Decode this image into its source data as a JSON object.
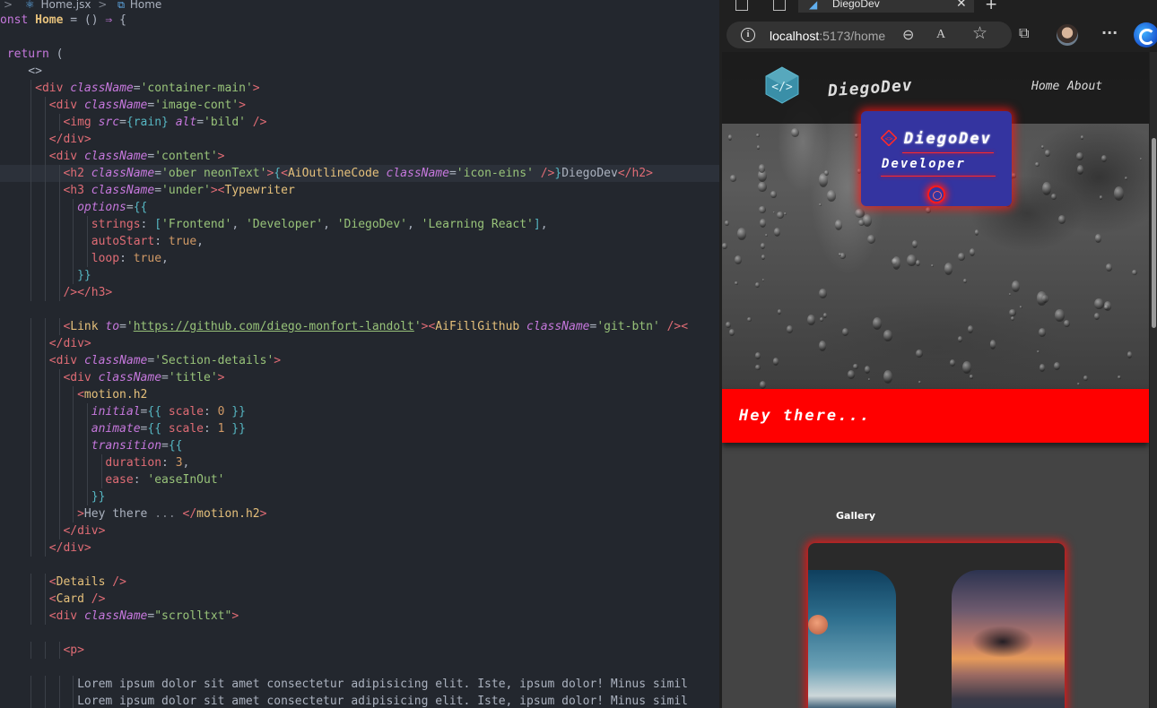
{
  "editor": {
    "breadcrumb": {
      "file": "Home.jsx",
      "separator": ">",
      "component": "Home"
    },
    "lines": [
      [
        [
          "tok-k",
          "onst "
        ],
        [
          "tok-fn",
          "Home"
        ],
        [
          "tok-p",
          " = () "
        ],
        [
          "tok-k",
          "⇒"
        ],
        [
          "tok-p",
          " {"
        ]
      ],
      [],
      [
        [
          "tok-k",
          " return "
        ],
        [
          "tok-p",
          "("
        ]
      ],
      [
        [
          "tok-p",
          "    <>"
        ]
      ],
      [
        [
          "tok-p",
          "     "
        ],
        [
          "tok-t",
          "<div "
        ],
        [
          "tok-a",
          "className"
        ],
        [
          "tok-p",
          "="
        ],
        [
          "tok-s",
          "'container-main'"
        ],
        [
          "tok-t",
          ">"
        ]
      ],
      [
        [
          "tok-p",
          "       "
        ],
        [
          "tok-t",
          "<div "
        ],
        [
          "tok-a",
          "className"
        ],
        [
          "tok-p",
          "="
        ],
        [
          "tok-s",
          "'image-cont'"
        ],
        [
          "tok-t",
          ">"
        ]
      ],
      [
        [
          "tok-p",
          "         "
        ],
        [
          "tok-t",
          "<img "
        ],
        [
          "tok-a",
          "src"
        ],
        [
          "tok-p",
          "="
        ],
        [
          "tok-b",
          "{rain}"
        ],
        [
          "tok-p",
          " "
        ],
        [
          "tok-a",
          "alt"
        ],
        [
          "tok-p",
          "="
        ],
        [
          "tok-s",
          "'bild'"
        ],
        [
          "tok-t",
          " />"
        ]
      ],
      [
        [
          "tok-p",
          "       "
        ],
        [
          "tok-t",
          "</div>"
        ]
      ],
      [
        [
          "tok-p",
          "       "
        ],
        [
          "tok-t",
          "<div "
        ],
        [
          "tok-a",
          "className"
        ],
        [
          "tok-p",
          "="
        ],
        [
          "tok-s",
          "'content'"
        ],
        [
          "tok-t",
          ">"
        ]
      ],
      [
        [
          "tok-p",
          "         "
        ],
        [
          "tok-t",
          "<h2 "
        ],
        [
          "tok-a",
          "className"
        ],
        [
          "tok-p",
          "="
        ],
        [
          "tok-s",
          "'ober neonText'"
        ],
        [
          "tok-t",
          ">"
        ],
        [
          "tok-b",
          "{"
        ],
        [
          "tok-t",
          "<"
        ],
        [
          "tok-c",
          "AiOutlineCode "
        ],
        [
          "tok-a",
          "className"
        ],
        [
          "tok-p",
          "="
        ],
        [
          "tok-s",
          "'icon-eins'"
        ],
        [
          "tok-t",
          " />"
        ],
        [
          "tok-b",
          "}"
        ],
        [
          "tok-w",
          "DiegoDev"
        ],
        [
          "tok-t",
          "</h2>"
        ]
      ],
      [
        [
          "tok-p",
          "         "
        ],
        [
          "tok-t",
          "<h3 "
        ],
        [
          "tok-a",
          "className"
        ],
        [
          "tok-p",
          "="
        ],
        [
          "tok-s",
          "'under'"
        ],
        [
          "tok-t",
          ">"
        ],
        [
          "tok-t",
          "<"
        ],
        [
          "tok-c",
          "Typewriter"
        ]
      ],
      [
        [
          "tok-p",
          "           "
        ],
        [
          "tok-a",
          "options"
        ],
        [
          "tok-p",
          "="
        ],
        [
          "tok-b",
          "{{"
        ]
      ],
      [
        [
          "tok-p",
          "             "
        ],
        [
          "tok-pr",
          "strings"
        ],
        [
          "tok-p",
          ": "
        ],
        [
          "tok-b",
          "["
        ],
        [
          "tok-s",
          "'Frontend'"
        ],
        [
          "tok-p",
          ", "
        ],
        [
          "tok-s",
          "'Developer'"
        ],
        [
          "tok-p",
          ", "
        ],
        [
          "tok-s",
          "'DiegoDev'"
        ],
        [
          "tok-p",
          ", "
        ],
        [
          "tok-s",
          "'Learning React'"
        ],
        [
          "tok-b",
          "]"
        ],
        [
          "tok-p",
          ","
        ]
      ],
      [
        [
          "tok-p",
          "             "
        ],
        [
          "tok-pr",
          "autoStart"
        ],
        [
          "tok-p",
          ": "
        ],
        [
          "tok-n",
          "true"
        ],
        [
          "tok-p",
          ","
        ]
      ],
      [
        [
          "tok-p",
          "             "
        ],
        [
          "tok-pr",
          "loop"
        ],
        [
          "tok-p",
          ": "
        ],
        [
          "tok-n",
          "true"
        ],
        [
          "tok-p",
          ","
        ]
      ],
      [
        [
          "tok-p",
          "           "
        ],
        [
          "tok-b",
          "}}"
        ]
      ],
      [
        [
          "tok-p",
          "         "
        ],
        [
          "tok-t",
          "/></h3>"
        ]
      ],
      [],
      [
        [
          "tok-p",
          "         "
        ],
        [
          "tok-t",
          "<"
        ],
        [
          "tok-c",
          "Link "
        ],
        [
          "tok-a",
          "to"
        ],
        [
          "tok-p",
          "="
        ],
        [
          "tok-s",
          "'"
        ],
        [
          "tok-u",
          "https://github.com/diego-monfort-landolt"
        ],
        [
          "tok-s",
          "'"
        ],
        [
          "tok-t",
          ">"
        ],
        [
          "tok-t",
          "<"
        ],
        [
          "tok-c",
          "AiFillGithub "
        ],
        [
          "tok-a",
          "className"
        ],
        [
          "tok-p",
          "="
        ],
        [
          "tok-s",
          "'git-btn'"
        ],
        [
          "tok-t",
          " /><"
        ]
      ],
      [
        [
          "tok-p",
          "       "
        ],
        [
          "tok-t",
          "</div>"
        ]
      ],
      [
        [
          "tok-p",
          "       "
        ],
        [
          "tok-t",
          "<div "
        ],
        [
          "tok-a",
          "className"
        ],
        [
          "tok-p",
          "="
        ],
        [
          "tok-s",
          "'Section-details'"
        ],
        [
          "tok-t",
          ">"
        ]
      ],
      [
        [
          "tok-p",
          "         "
        ],
        [
          "tok-t",
          "<div "
        ],
        [
          "tok-a",
          "className"
        ],
        [
          "tok-p",
          "="
        ],
        [
          "tok-s",
          "'title'"
        ],
        [
          "tok-t",
          ">"
        ]
      ],
      [
        [
          "tok-p",
          "           "
        ],
        [
          "tok-t",
          "<"
        ],
        [
          "tok-c",
          "motion.h2"
        ]
      ],
      [
        [
          "tok-p",
          "             "
        ],
        [
          "tok-a",
          "initial"
        ],
        [
          "tok-p",
          "="
        ],
        [
          "tok-b",
          "{{ "
        ],
        [
          "tok-pr",
          "scale"
        ],
        [
          "tok-p",
          ": "
        ],
        [
          "tok-n",
          "0"
        ],
        [
          "tok-b",
          " }}"
        ]
      ],
      [
        [
          "tok-p",
          "             "
        ],
        [
          "tok-a",
          "animate"
        ],
        [
          "tok-p",
          "="
        ],
        [
          "tok-b",
          "{{ "
        ],
        [
          "tok-pr",
          "scale"
        ],
        [
          "tok-p",
          ": "
        ],
        [
          "tok-n",
          "1"
        ],
        [
          "tok-b",
          " }}"
        ]
      ],
      [
        [
          "tok-p",
          "             "
        ],
        [
          "tok-a",
          "transition"
        ],
        [
          "tok-p",
          "="
        ],
        [
          "tok-b",
          "{{"
        ]
      ],
      [
        [
          "tok-p",
          "               "
        ],
        [
          "tok-pr",
          "duration"
        ],
        [
          "tok-p",
          ": "
        ],
        [
          "tok-n",
          "3"
        ],
        [
          "tok-p",
          ","
        ]
      ],
      [
        [
          "tok-p",
          "               "
        ],
        [
          "tok-pr",
          "ease"
        ],
        [
          "tok-p",
          ": "
        ],
        [
          "tok-s",
          "'easeInOut'"
        ]
      ],
      [
        [
          "tok-p",
          "             "
        ],
        [
          "tok-b",
          "}}"
        ]
      ],
      [
        [
          "tok-p",
          "           "
        ],
        [
          "tok-t",
          ">"
        ],
        [
          "tok-w",
          "Hey there"
        ],
        [
          "tok-dots",
          " ..."
        ],
        [
          "tok-w",
          " "
        ],
        [
          "tok-t",
          "</"
        ],
        [
          "tok-c",
          "motion.h2"
        ],
        [
          "tok-t",
          ">"
        ]
      ],
      [
        [
          "tok-p",
          "         "
        ],
        [
          "tok-t",
          "</div>"
        ]
      ],
      [
        [
          "tok-p",
          "       "
        ],
        [
          "tok-t",
          "</div>"
        ]
      ],
      [],
      [
        [
          "tok-p",
          "       "
        ],
        [
          "tok-t",
          "<"
        ],
        [
          "tok-c",
          "Details "
        ],
        [
          "tok-t",
          "/>"
        ]
      ],
      [
        [
          "tok-p",
          "       "
        ],
        [
          "tok-t",
          "<"
        ],
        [
          "tok-c",
          "Card "
        ],
        [
          "tok-t",
          "/>"
        ]
      ],
      [
        [
          "tok-p",
          "       "
        ],
        [
          "tok-t",
          "<div "
        ],
        [
          "tok-a",
          "className"
        ],
        [
          "tok-p",
          "="
        ],
        [
          "tok-s",
          "\"scrolltxt\""
        ],
        [
          "tok-t",
          ">"
        ]
      ],
      [],
      [
        [
          "tok-p",
          "         "
        ],
        [
          "tok-t",
          "<p>"
        ]
      ],
      [],
      [
        [
          "tok-w",
          "           Lorem ipsum dolor sit amet consectetur adipisicing elit. Iste, ipsum dolor! Minus simil"
        ]
      ],
      [
        [
          "tok-w",
          "           Lorem ipsum dolor sit amet consectetur adipisicing elit. Iste, ipsum dolor! Minus simil"
        ]
      ]
    ]
  },
  "browser": {
    "tab": {
      "title": "DiegoDev",
      "close": "✕",
      "new_tab": "+"
    },
    "address": {
      "host": "localhost",
      "rest": ":5173/home"
    },
    "toolbar": {
      "zoom": "⊖",
      "read_aloud": "A",
      "favorite": "☆",
      "split": "⧉",
      "more": "···"
    },
    "page": {
      "brand": "DiegoDev",
      "nav": {
        "home": "Home",
        "about": "About"
      },
      "neon": {
        "title": "DiegoDev",
        "subtitle": "Developer"
      },
      "hey": "Hey there...",
      "gallery_title": "Gallery"
    }
  }
}
